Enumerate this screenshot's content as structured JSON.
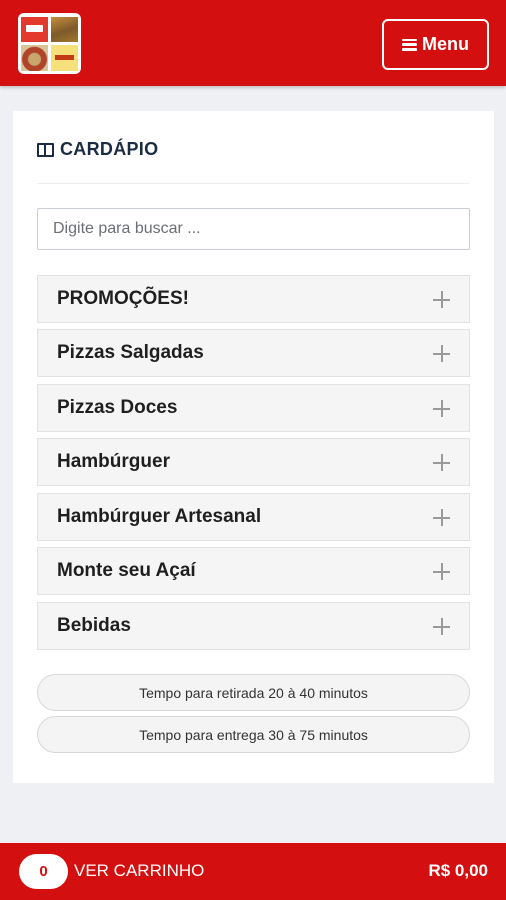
{
  "header": {
    "menu_label": "Menu"
  },
  "card": {
    "title": "CARDÁPIO",
    "search_placeholder": "Digite para buscar ..."
  },
  "categories": [
    {
      "label": "PROMOÇÕES!"
    },
    {
      "label": "Pizzas Salgadas"
    },
    {
      "label": "Pizzas Doces"
    },
    {
      "label": "Hambúrguer"
    },
    {
      "label": "Hambúrguer Artesanal"
    },
    {
      "label": "Monte seu Açaí"
    },
    {
      "label": "Bebidas"
    }
  ],
  "info": {
    "pickup_time": "Tempo para retirada 20 à 40 minutos",
    "delivery_time": "Tempo para entrega 30 à 75 minutos"
  },
  "footer": {
    "cart_count": "0",
    "cart_label": "VER CARRINHO",
    "total": "R$ 0,00"
  },
  "colors": {
    "brand_red": "#d40f0f"
  },
  "icons": [
    "menu-icon",
    "book-icon",
    "plus-icon"
  ]
}
